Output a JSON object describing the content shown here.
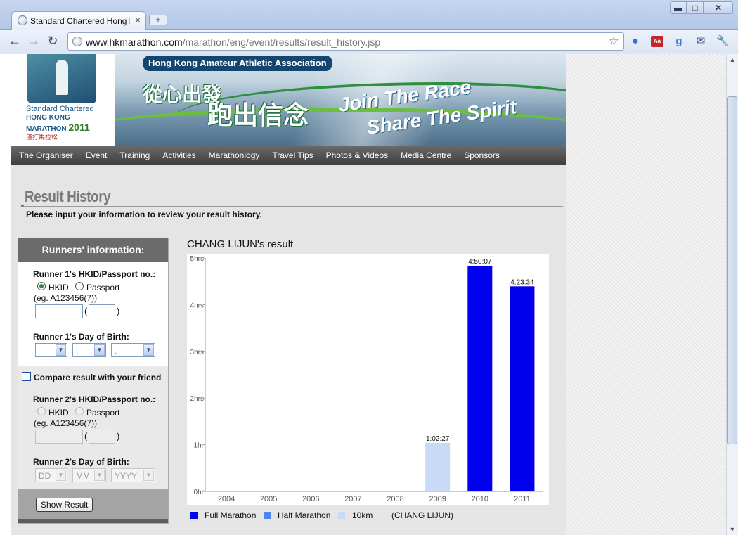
{
  "browser": {
    "tab_title": "Standard Chartered Hong Kon",
    "tab_close": "×",
    "new_tab": "+",
    "url_host": "www.hkmarathon.com",
    "url_path": "/marathon/eng/event/results/result_history.jsp",
    "window_buttons": {
      "minimize": "▬",
      "maximize": "□",
      "close": "✕"
    },
    "nav": {
      "back": "←",
      "forward": "→",
      "reload": "↻"
    },
    "extensions": {
      "pdf_label": "Aa",
      "gplus_label": "g",
      "star": "☆"
    }
  },
  "banner": {
    "logo_line1": "Standard Chartered",
    "logo_line2": "HONG KONG",
    "logo_line3": "MARATHON",
    "logo_year": "2011",
    "logo_line4": "渣打馬拉松",
    "association": "Hong Kong Amateur Athletic Association",
    "slogan_cn1": "從心出發",
    "slogan_cn2": "跑出信念",
    "slogan_en1": "Join The Race",
    "slogan_en2": "Share The Spirit"
  },
  "site_nav": [
    "The Organiser",
    "Event",
    "Training",
    "Activities",
    "Marathonlogy",
    "Travel Tips",
    "Photos & Videos",
    "Media Centre",
    "Sponsors"
  ],
  "page": {
    "heading": "Result History",
    "subtitle": "Please input your information to review your result history."
  },
  "form": {
    "panel_title": "Runners' information:",
    "r1_id_label": "Runner 1's HKID/Passport no.:",
    "opt_hkid": "HKID",
    "opt_passport": "Passport",
    "example": "(eg. A123456(7))",
    "paren_open": "(",
    "paren_close": ")",
    "r1_dob_label": "Runner 1's Day of Birth:",
    "r1_dob_values": [
      "",
      ".",
      ","
    ],
    "compare_label": "Compare result with your friend",
    "r2_id_label": "Runner 2's HKID/Passport no.:",
    "r2_dob_label": "Runner 2's Day of Birth:",
    "r2_dob_placeholders": [
      "DD",
      "MM",
      "YYYY"
    ],
    "show_button": "Show Result"
  },
  "colors": {
    "full": "#0000ee",
    "half": "#4d86e6",
    "tenk": "#c8daf5"
  },
  "chart_data": {
    "type": "bar",
    "title": "CHANG LIJUN's result",
    "categories": [
      "2004",
      "2005",
      "2006",
      "2007",
      "2008",
      "2009",
      "2010",
      "2011"
    ],
    "ytick_labels": [
      "0hr",
      "1hr",
      "2hrs",
      "3hrs",
      "4hrs",
      "5hrs"
    ],
    "ylim": [
      0,
      5
    ],
    "series": [
      {
        "name": "Full Marathon",
        "color": "#0000ee",
        "values": [
          null,
          null,
          null,
          null,
          null,
          null,
          4.835,
          4.393
        ],
        "labels": [
          "",
          "",
          "",
          "",
          "",
          "",
          "4:50:07",
          "4:23:34"
        ]
      },
      {
        "name": "Half Marathon",
        "color": "#4d86e6",
        "values": [
          null,
          null,
          null,
          null,
          null,
          null,
          null,
          null
        ],
        "labels": [
          "",
          "",
          "",
          "",
          "",
          "",
          "",
          ""
        ]
      },
      {
        "name": "10km",
        "color": "#c8daf5",
        "values": [
          null,
          null,
          null,
          null,
          null,
          1.041,
          null,
          null
        ],
        "labels": [
          "",
          "",
          "",
          "",
          "",
          "1:02:27",
          "",
          ""
        ]
      }
    ],
    "legend_note": "(CHANG LIJUN)",
    "legend_position": "bottom"
  }
}
